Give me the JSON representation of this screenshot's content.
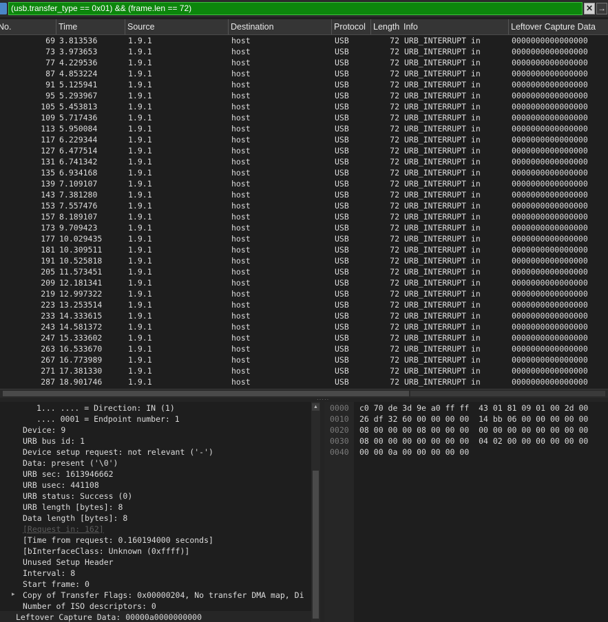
{
  "filter": {
    "text": "(usb.transfer_type == 0x01) && (frame.len == 72)",
    "clear_label": "✕",
    "apply_label": "→",
    "color": "#0c860c"
  },
  "columns": {
    "no": "No.",
    "time": "Time",
    "source": "Source",
    "destination": "Destination",
    "protocol": "Protocol",
    "length": "Length",
    "info": "Info",
    "leftover": "Leftover Capture Data"
  },
  "packets": [
    {
      "no": "69",
      "time": "3.813536",
      "src": "1.9.1",
      "dst": "host",
      "proto": "USB",
      "len": "72",
      "info": "URB_INTERRUPT in",
      "leftover": "0000000000000000"
    },
    {
      "no": "73",
      "time": "3.973653",
      "src": "1.9.1",
      "dst": "host",
      "proto": "USB",
      "len": "72",
      "info": "URB_INTERRUPT in",
      "leftover": "0000000000000000"
    },
    {
      "no": "77",
      "time": "4.229536",
      "src": "1.9.1",
      "dst": "host",
      "proto": "USB",
      "len": "72",
      "info": "URB_INTERRUPT in",
      "leftover": "0000000000000000"
    },
    {
      "no": "87",
      "time": "4.853224",
      "src": "1.9.1",
      "dst": "host",
      "proto": "USB",
      "len": "72",
      "info": "URB_INTERRUPT in",
      "leftover": "0000000000000000"
    },
    {
      "no": "91",
      "time": "5.125941",
      "src": "1.9.1",
      "dst": "host",
      "proto": "USB",
      "len": "72",
      "info": "URB_INTERRUPT in",
      "leftover": "0000000000000000"
    },
    {
      "no": "95",
      "time": "5.293967",
      "src": "1.9.1",
      "dst": "host",
      "proto": "USB",
      "len": "72",
      "info": "URB_INTERRUPT in",
      "leftover": "0000000000000000"
    },
    {
      "no": "105",
      "time": "5.453813",
      "src": "1.9.1",
      "dst": "host",
      "proto": "USB",
      "len": "72",
      "info": "URB_INTERRUPT in",
      "leftover": "0000000000000000"
    },
    {
      "no": "109",
      "time": "5.717436",
      "src": "1.9.1",
      "dst": "host",
      "proto": "USB",
      "len": "72",
      "info": "URB_INTERRUPT in",
      "leftover": "0000000000000000"
    },
    {
      "no": "113",
      "time": "5.950084",
      "src": "1.9.1",
      "dst": "host",
      "proto": "USB",
      "len": "72",
      "info": "URB_INTERRUPT in",
      "leftover": "0000000000000000"
    },
    {
      "no": "117",
      "time": "6.229344",
      "src": "1.9.1",
      "dst": "host",
      "proto": "USB",
      "len": "72",
      "info": "URB_INTERRUPT in",
      "leftover": "0000000000000000"
    },
    {
      "no": "127",
      "time": "6.477514",
      "src": "1.9.1",
      "dst": "host",
      "proto": "USB",
      "len": "72",
      "info": "URB_INTERRUPT in",
      "leftover": "0000000000000000"
    },
    {
      "no": "131",
      "time": "6.741342",
      "src": "1.9.1",
      "dst": "host",
      "proto": "USB",
      "len": "72",
      "info": "URB_INTERRUPT in",
      "leftover": "0000000000000000"
    },
    {
      "no": "135",
      "time": "6.934168",
      "src": "1.9.1",
      "dst": "host",
      "proto": "USB",
      "len": "72",
      "info": "URB_INTERRUPT in",
      "leftover": "0000000000000000"
    },
    {
      "no": "139",
      "time": "7.109107",
      "src": "1.9.1",
      "dst": "host",
      "proto": "USB",
      "len": "72",
      "info": "URB_INTERRUPT in",
      "leftover": "0000000000000000"
    },
    {
      "no": "143",
      "time": "7.381280",
      "src": "1.9.1",
      "dst": "host",
      "proto": "USB",
      "len": "72",
      "info": "URB_INTERRUPT in",
      "leftover": "0000000000000000"
    },
    {
      "no": "153",
      "time": "7.557476",
      "src": "1.9.1",
      "dst": "host",
      "proto": "USB",
      "len": "72",
      "info": "URB_INTERRUPT in",
      "leftover": "0000000000000000"
    },
    {
      "no": "157",
      "time": "8.189107",
      "src": "1.9.1",
      "dst": "host",
      "proto": "USB",
      "len": "72",
      "info": "URB_INTERRUPT in",
      "leftover": "0000000000000000"
    },
    {
      "no": "173",
      "time": "9.709423",
      "src": "1.9.1",
      "dst": "host",
      "proto": "USB",
      "len": "72",
      "info": "URB_INTERRUPT in",
      "leftover": "0000000000000000"
    },
    {
      "no": "177",
      "time": "10.029435",
      "src": "1.9.1",
      "dst": "host",
      "proto": "USB",
      "len": "72",
      "info": "URB_INTERRUPT in",
      "leftover": "0000000000000000"
    },
    {
      "no": "181",
      "time": "10.309511",
      "src": "1.9.1",
      "dst": "host",
      "proto": "USB",
      "len": "72",
      "info": "URB_INTERRUPT in",
      "leftover": "0000000000000000"
    },
    {
      "no": "191",
      "time": "10.525818",
      "src": "1.9.1",
      "dst": "host",
      "proto": "USB",
      "len": "72",
      "info": "URB_INTERRUPT in",
      "leftover": "0000000000000000"
    },
    {
      "no": "205",
      "time": "11.573451",
      "src": "1.9.1",
      "dst": "host",
      "proto": "USB",
      "len": "72",
      "info": "URB_INTERRUPT in",
      "leftover": "0000000000000000"
    },
    {
      "no": "209",
      "time": "12.181341",
      "src": "1.9.1",
      "dst": "host",
      "proto": "USB",
      "len": "72",
      "info": "URB_INTERRUPT in",
      "leftover": "0000000000000000"
    },
    {
      "no": "219",
      "time": "12.997322",
      "src": "1.9.1",
      "dst": "host",
      "proto": "USB",
      "len": "72",
      "info": "URB_INTERRUPT in",
      "leftover": "0000000000000000"
    },
    {
      "no": "223",
      "time": "13.253514",
      "src": "1.9.1",
      "dst": "host",
      "proto": "USB",
      "len": "72",
      "info": "URB_INTERRUPT in",
      "leftover": "0000000000000000"
    },
    {
      "no": "233",
      "time": "14.333615",
      "src": "1.9.1",
      "dst": "host",
      "proto": "USB",
      "len": "72",
      "info": "URB_INTERRUPT in",
      "leftover": "0000000000000000"
    },
    {
      "no": "243",
      "time": "14.581372",
      "src": "1.9.1",
      "dst": "host",
      "proto": "USB",
      "len": "72",
      "info": "URB_INTERRUPT in",
      "leftover": "0000000000000000"
    },
    {
      "no": "247",
      "time": "15.333602",
      "src": "1.9.1",
      "dst": "host",
      "proto": "USB",
      "len": "72",
      "info": "URB_INTERRUPT in",
      "leftover": "0000000000000000"
    },
    {
      "no": "263",
      "time": "16.533670",
      "src": "1.9.1",
      "dst": "host",
      "proto": "USB",
      "len": "72",
      "info": "URB_INTERRUPT in",
      "leftover": "0000000000000000"
    },
    {
      "no": "267",
      "time": "16.773989",
      "src": "1.9.1",
      "dst": "host",
      "proto": "USB",
      "len": "72",
      "info": "URB_INTERRUPT in",
      "leftover": "0000000000000000"
    },
    {
      "no": "271",
      "time": "17.381330",
      "src": "1.9.1",
      "dst": "host",
      "proto": "USB",
      "len": "72",
      "info": "URB_INTERRUPT in",
      "leftover": "0000000000000000"
    },
    {
      "no": "287",
      "time": "18.901746",
      "src": "1.9.1",
      "dst": "host",
      "proto": "USB",
      "len": "72",
      "info": "URB_INTERRUPT in",
      "leftover": "0000000000000000"
    }
  ],
  "details": [
    {
      "text": "1... .... = Direction: IN (1)",
      "indent": 4,
      "dim": false,
      "expander": false
    },
    {
      "text": ".... 0001 = Endpoint number: 1",
      "indent": 4,
      "dim": false,
      "expander": false
    },
    {
      "text": "Device: 9",
      "indent": 2,
      "dim": false,
      "expander": false
    },
    {
      "text": "URB bus id: 1",
      "indent": 2,
      "dim": false,
      "expander": false
    },
    {
      "text": "Device setup request: not relevant ('-')",
      "indent": 2,
      "dim": false,
      "expander": false
    },
    {
      "text": "Data: present ('\\0')",
      "indent": 2,
      "dim": false,
      "expander": false
    },
    {
      "text": "URB sec: 1613946662",
      "indent": 2,
      "dim": false,
      "expander": false
    },
    {
      "text": "URB usec: 441108",
      "indent": 2,
      "dim": false,
      "expander": false
    },
    {
      "text": "URB status: Success (0)",
      "indent": 2,
      "dim": false,
      "expander": false
    },
    {
      "text": "URB length [bytes]: 8",
      "indent": 2,
      "dim": false,
      "expander": false
    },
    {
      "text": "Data length [bytes]: 8",
      "indent": 2,
      "dim": false,
      "expander": false
    },
    {
      "text": "[Request in: 162]",
      "indent": 2,
      "dim": true,
      "expander": false
    },
    {
      "text": "[Time from request: 0.160194000 seconds]",
      "indent": 2,
      "dim": false,
      "expander": false
    },
    {
      "text": "[bInterfaceClass: Unknown (0xffff)]",
      "indent": 2,
      "dim": false,
      "expander": false
    },
    {
      "text": "Unused Setup Header",
      "indent": 2,
      "dim": false,
      "expander": false
    },
    {
      "text": "Interval: 8",
      "indent": 2,
      "dim": false,
      "expander": false
    },
    {
      "text": "Start frame: 0",
      "indent": 2,
      "dim": false,
      "expander": false
    },
    {
      "text": "Copy of Transfer Flags: 0x00000204, No transfer DMA map, Di",
      "indent": 2,
      "dim": false,
      "expander": true
    },
    {
      "text": "Number of ISO descriptors: 0",
      "indent": 2,
      "dim": false,
      "expander": false
    },
    {
      "text": "Leftover Capture Data: 00000a0000000000",
      "indent": 1,
      "dim": false,
      "expander": false
    }
  ],
  "bytes": [
    {
      "offset": "0000",
      "hex": "c0 70 de 3d 9e a0 ff ff  43 01 81 09 01 00 2d 00"
    },
    {
      "offset": "0010",
      "hex": "26 df 32 60 00 00 00 00  14 bb 06 00 00 00 00 00"
    },
    {
      "offset": "0020",
      "hex": "08 00 00 00 08 00 00 00  00 00 00 00 00 00 00 00"
    },
    {
      "offset": "0030",
      "hex": "08 00 00 00 00 00 00 00  04 02 00 00 00 00 00 00"
    },
    {
      "offset": "0040",
      "hex": "00 00 0a 00 00 00 00 00"
    }
  ],
  "icons": {
    "bookmark": "filter-bookmark-icon",
    "expander": "▸",
    "scroll_up": "▲",
    "splitter_grip": "·····"
  }
}
